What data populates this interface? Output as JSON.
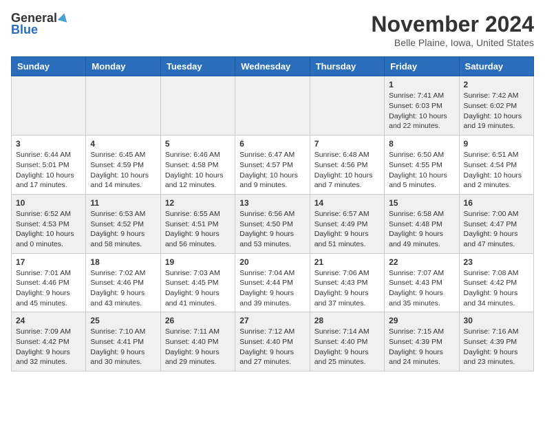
{
  "logo": {
    "general": "General",
    "blue": "Blue"
  },
  "title": {
    "month": "November 2024",
    "location": "Belle Plaine, Iowa, United States"
  },
  "headers": [
    "Sunday",
    "Monday",
    "Tuesday",
    "Wednesday",
    "Thursday",
    "Friday",
    "Saturday"
  ],
  "weeks": [
    [
      {
        "day": "",
        "info": ""
      },
      {
        "day": "",
        "info": ""
      },
      {
        "day": "",
        "info": ""
      },
      {
        "day": "",
        "info": ""
      },
      {
        "day": "",
        "info": ""
      },
      {
        "day": "1",
        "info": "Sunrise: 7:41 AM\nSunset: 6:03 PM\nDaylight: 10 hours\nand 22 minutes."
      },
      {
        "day": "2",
        "info": "Sunrise: 7:42 AM\nSunset: 6:02 PM\nDaylight: 10 hours\nand 19 minutes."
      }
    ],
    [
      {
        "day": "3",
        "info": "Sunrise: 6:44 AM\nSunset: 5:01 PM\nDaylight: 10 hours\nand 17 minutes."
      },
      {
        "day": "4",
        "info": "Sunrise: 6:45 AM\nSunset: 4:59 PM\nDaylight: 10 hours\nand 14 minutes."
      },
      {
        "day": "5",
        "info": "Sunrise: 6:46 AM\nSunset: 4:58 PM\nDaylight: 10 hours\nand 12 minutes."
      },
      {
        "day": "6",
        "info": "Sunrise: 6:47 AM\nSunset: 4:57 PM\nDaylight: 10 hours\nand 9 minutes."
      },
      {
        "day": "7",
        "info": "Sunrise: 6:48 AM\nSunset: 4:56 PM\nDaylight: 10 hours\nand 7 minutes."
      },
      {
        "day": "8",
        "info": "Sunrise: 6:50 AM\nSunset: 4:55 PM\nDaylight: 10 hours\nand 5 minutes."
      },
      {
        "day": "9",
        "info": "Sunrise: 6:51 AM\nSunset: 4:54 PM\nDaylight: 10 hours\nand 2 minutes."
      }
    ],
    [
      {
        "day": "10",
        "info": "Sunrise: 6:52 AM\nSunset: 4:53 PM\nDaylight: 10 hours\nand 0 minutes."
      },
      {
        "day": "11",
        "info": "Sunrise: 6:53 AM\nSunset: 4:52 PM\nDaylight: 9 hours\nand 58 minutes."
      },
      {
        "day": "12",
        "info": "Sunrise: 6:55 AM\nSunset: 4:51 PM\nDaylight: 9 hours\nand 56 minutes."
      },
      {
        "day": "13",
        "info": "Sunrise: 6:56 AM\nSunset: 4:50 PM\nDaylight: 9 hours\nand 53 minutes."
      },
      {
        "day": "14",
        "info": "Sunrise: 6:57 AM\nSunset: 4:49 PM\nDaylight: 9 hours\nand 51 minutes."
      },
      {
        "day": "15",
        "info": "Sunrise: 6:58 AM\nSunset: 4:48 PM\nDaylight: 9 hours\nand 49 minutes."
      },
      {
        "day": "16",
        "info": "Sunrise: 7:00 AM\nSunset: 4:47 PM\nDaylight: 9 hours\nand 47 minutes."
      }
    ],
    [
      {
        "day": "17",
        "info": "Sunrise: 7:01 AM\nSunset: 4:46 PM\nDaylight: 9 hours\nand 45 minutes."
      },
      {
        "day": "18",
        "info": "Sunrise: 7:02 AM\nSunset: 4:46 PM\nDaylight: 9 hours\nand 43 minutes."
      },
      {
        "day": "19",
        "info": "Sunrise: 7:03 AM\nSunset: 4:45 PM\nDaylight: 9 hours\nand 41 minutes."
      },
      {
        "day": "20",
        "info": "Sunrise: 7:04 AM\nSunset: 4:44 PM\nDaylight: 9 hours\nand 39 minutes."
      },
      {
        "day": "21",
        "info": "Sunrise: 7:06 AM\nSunset: 4:43 PM\nDaylight: 9 hours\nand 37 minutes."
      },
      {
        "day": "22",
        "info": "Sunrise: 7:07 AM\nSunset: 4:43 PM\nDaylight: 9 hours\nand 35 minutes."
      },
      {
        "day": "23",
        "info": "Sunrise: 7:08 AM\nSunset: 4:42 PM\nDaylight: 9 hours\nand 34 minutes."
      }
    ],
    [
      {
        "day": "24",
        "info": "Sunrise: 7:09 AM\nSunset: 4:42 PM\nDaylight: 9 hours\nand 32 minutes."
      },
      {
        "day": "25",
        "info": "Sunrise: 7:10 AM\nSunset: 4:41 PM\nDaylight: 9 hours\nand 30 minutes."
      },
      {
        "day": "26",
        "info": "Sunrise: 7:11 AM\nSunset: 4:40 PM\nDaylight: 9 hours\nand 29 minutes."
      },
      {
        "day": "27",
        "info": "Sunrise: 7:12 AM\nSunset: 4:40 PM\nDaylight: 9 hours\nand 27 minutes."
      },
      {
        "day": "28",
        "info": "Sunrise: 7:14 AM\nSunset: 4:40 PM\nDaylight: 9 hours\nand 25 minutes."
      },
      {
        "day": "29",
        "info": "Sunrise: 7:15 AM\nSunset: 4:39 PM\nDaylight: 9 hours\nand 24 minutes."
      },
      {
        "day": "30",
        "info": "Sunrise: 7:16 AM\nSunset: 4:39 PM\nDaylight: 9 hours\nand 23 minutes."
      }
    ]
  ]
}
